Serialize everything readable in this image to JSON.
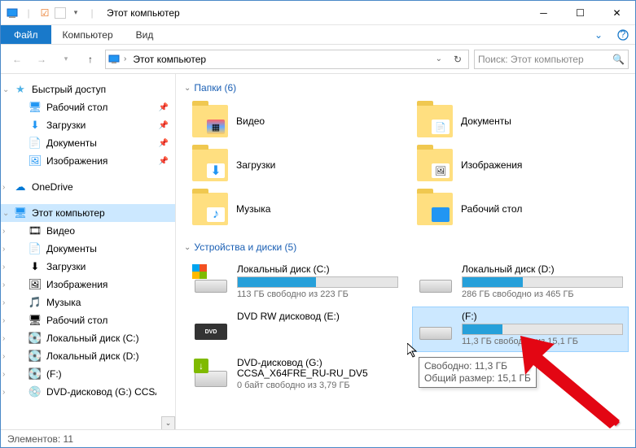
{
  "window": {
    "title": "Этот компьютер"
  },
  "ribbon": {
    "file": "Файл",
    "computer": "Компьютер",
    "view": "Вид"
  },
  "address": {
    "crumb": "Этот компьютер"
  },
  "search": {
    "placeholder": "Поиск: Этот компьютер"
  },
  "nav": {
    "quick_access": "Быстрый доступ",
    "desktop": "Рабочий стол",
    "downloads": "Загрузки",
    "documents": "Документы",
    "pictures": "Изображения",
    "onedrive": "OneDrive",
    "this_pc": "Этот компьютер",
    "videos": "Видео",
    "documents2": "Документы",
    "downloads2": "Загрузки",
    "pictures2": "Изображения",
    "music": "Музыка",
    "desktop2": "Рабочий стол",
    "drive_c": "Локальный диск (C:)",
    "drive_d": "Локальный диск (D:)",
    "drive_f": "(F:)",
    "drive_g": "DVD-дисковод (G:) CCSA_)"
  },
  "groups": {
    "folders": {
      "title": "Папки (6)"
    },
    "drives": {
      "title": "Устройства и диски (5)"
    }
  },
  "folders": {
    "videos": "Видео",
    "documents": "Документы",
    "downloads": "Загрузки",
    "pictures": "Изображения",
    "music": "Музыка",
    "desktop": "Рабочий стол"
  },
  "drives": {
    "c": {
      "name": "Локальный диск (C:)",
      "free": "113 ГБ свободно из 223 ГБ",
      "pct": 49
    },
    "d": {
      "name": "Локальный диск (D:)",
      "free": "286 ГБ свободно из 465 ГБ",
      "pct": 38
    },
    "e": {
      "name": "DVD RW дисковод (E:)",
      "free": ""
    },
    "f": {
      "name": "(F:)",
      "free": "11,3 ГБ свободно из 15,1 ГБ",
      "pct": 25
    },
    "g": {
      "name": "DVD-дисковод (G:) CCSA_X64FRE_RU-RU_DV5",
      "free": "0 байт свободно из 3,79 ГБ"
    }
  },
  "tooltip": {
    "line1": "Свободно: 11,3 ГБ",
    "line2": "Общий размер: 15,1 ГБ"
  },
  "status": {
    "text": "Элементов: 11"
  }
}
